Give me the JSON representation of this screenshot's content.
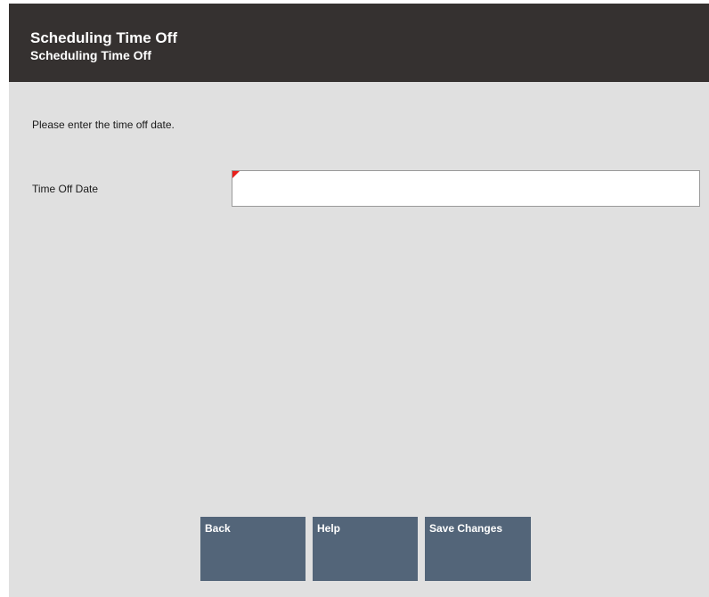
{
  "header": {
    "title": "Scheduling Time Off",
    "subtitle": "Scheduling Time Off"
  },
  "prompt": "Please enter the time off date.",
  "form": {
    "time_off_date": {
      "label": "Time Off Date",
      "value": "",
      "required": true
    }
  },
  "buttons": {
    "back": "Back",
    "help": "Help",
    "save_changes": "Save Changes"
  },
  "colors": {
    "header_bg": "#353130",
    "body_bg": "#e0e0e0",
    "button_bg": "#536579",
    "required_marker": "#e8201c"
  }
}
